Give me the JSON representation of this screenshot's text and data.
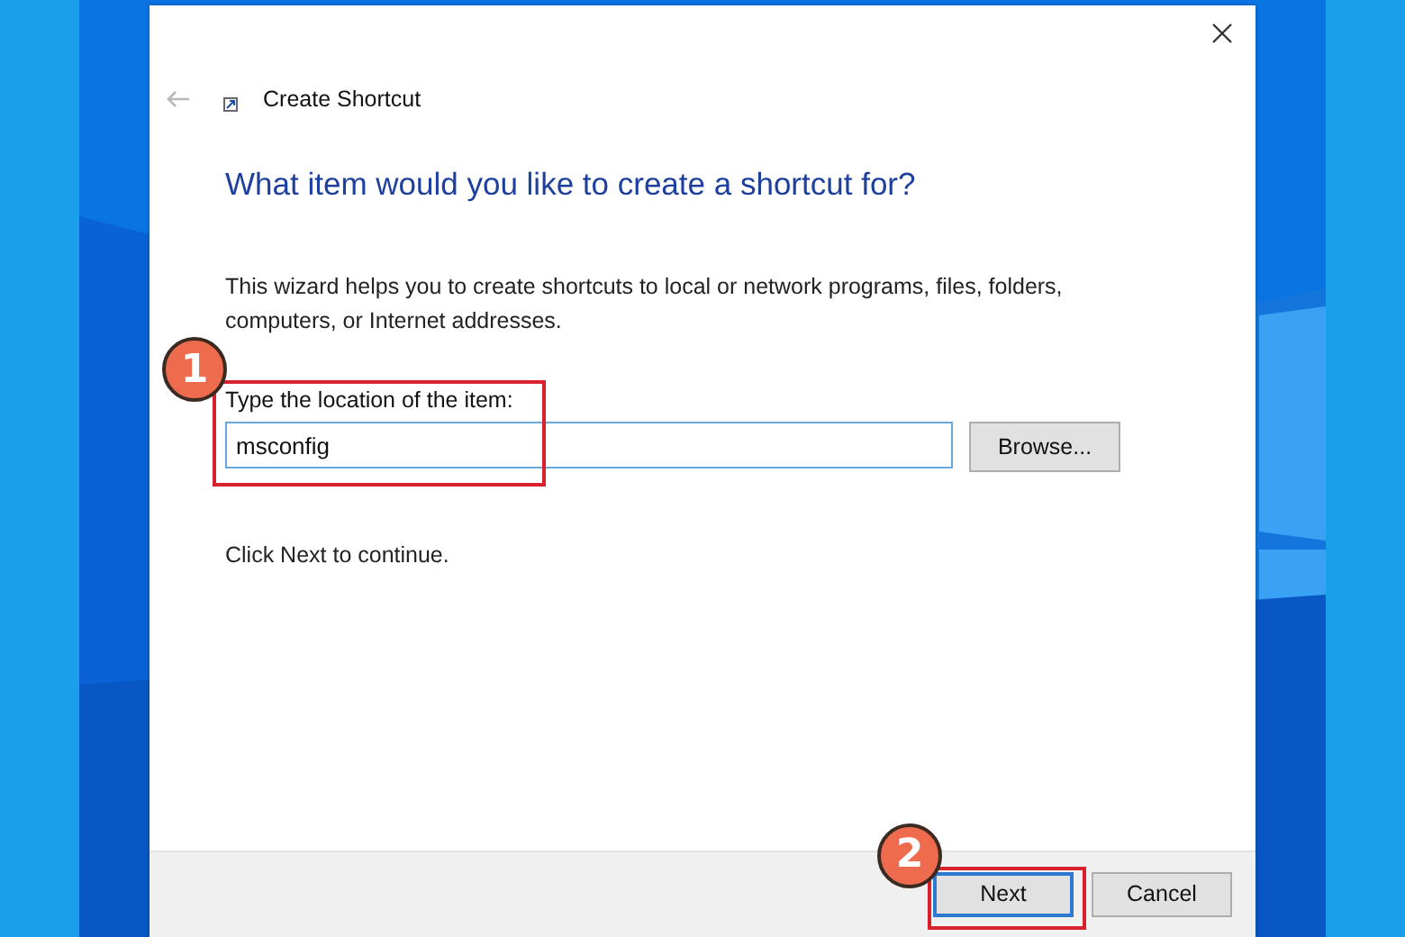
{
  "dialog": {
    "title": "Create Shortcut",
    "back_disabled": true,
    "heading": "What item would you like to create a shortcut for?",
    "description": "This wizard helps you to create shortcuts to local or network programs, files, folders, computers, or Internet addresses.",
    "field": {
      "label": "Type the location of the item:",
      "value": "msconfig",
      "step": "1"
    },
    "browse": "Browse...",
    "hint": "Click Next to continue.",
    "buttons": [
      {
        "label": "Next",
        "default": true,
        "step": "2"
      },
      {
        "label": "Cancel",
        "default": false
      }
    ]
  }
}
